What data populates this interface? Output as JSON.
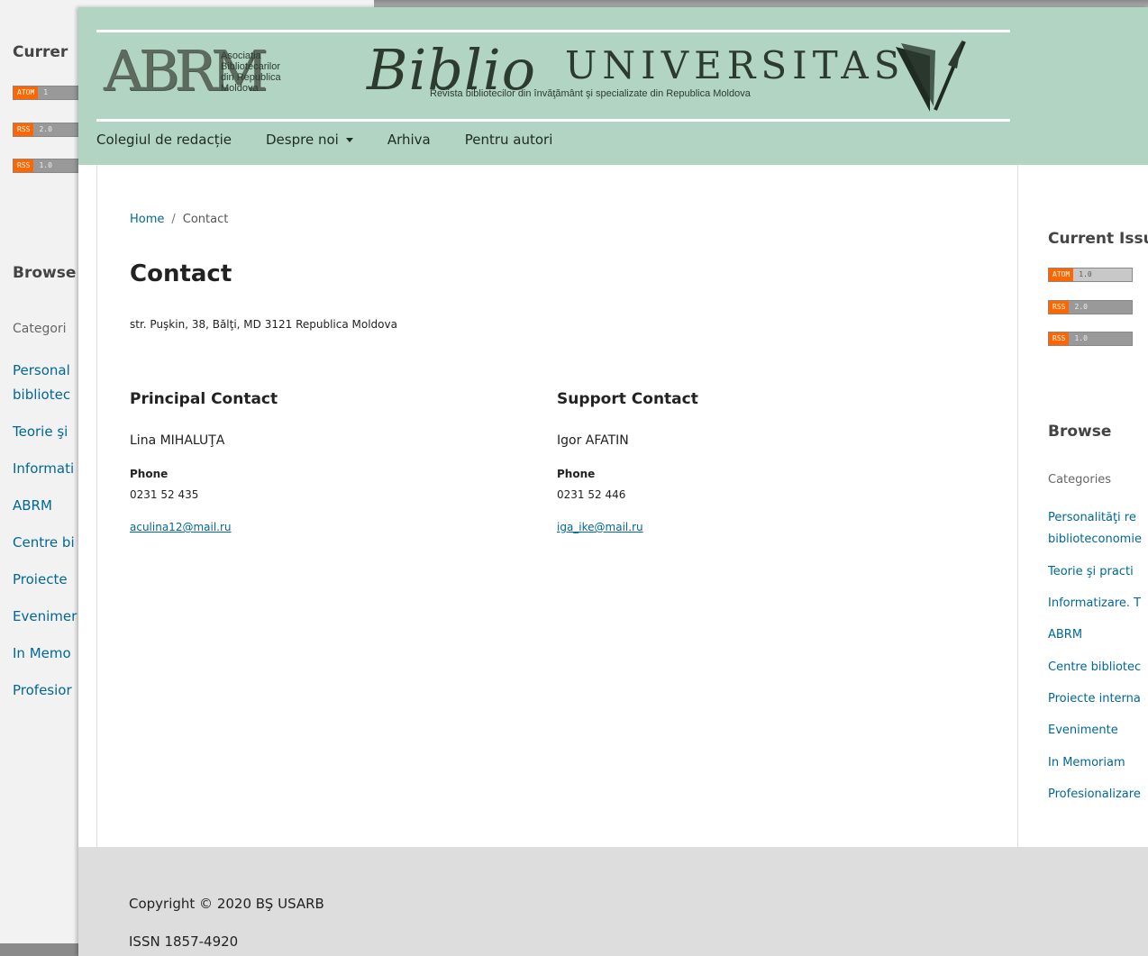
{
  "background_window": {
    "current_title": "Currer",
    "browse_title": "Browse",
    "categories_label": "Categori",
    "categories": [
      "Personal",
      "bibliotec",
      "Teorie şi",
      "Informati",
      "ABRM",
      "Centre bi",
      "Proiecte",
      "Evenimer",
      "In Memo",
      "Profesior"
    ],
    "feeds": [
      {
        "left": "ATOM",
        "right": "1"
      },
      {
        "left": "RSS",
        "right": "2.0"
      },
      {
        "left": "RSS",
        "right": "1.0"
      }
    ]
  },
  "banner": {
    "abrm": "ABRM",
    "abrm_subtitle": [
      "Asociația",
      "Bibliotecarilor",
      "din Republica",
      "Moldova"
    ],
    "biblio": "Biblio",
    "universitas": "UNIVERSITAS",
    "tagline": "Revista bibliotecilor din învăţământ şi specializate din Republica Moldova"
  },
  "nav": {
    "items": [
      {
        "label": "Colegiul de redacție"
      },
      {
        "label": "Despre noi"
      },
      {
        "label": "Arhiva"
      },
      {
        "label": "Pentru autori"
      }
    ]
  },
  "breadcrumb": {
    "home": "Home",
    "separator": "/",
    "current": "Contact"
  },
  "page": {
    "title": "Contact",
    "address": "str. Puşkin, 38, Bălţi, MD 3121 Republica Moldova"
  },
  "principal": {
    "heading": "Principal Contact",
    "name": "Lina MIHALUŢA",
    "phone_label": "Phone",
    "phone": "0231 52 435",
    "email": "aculina12@mail.ru"
  },
  "support": {
    "heading": "Support Contact",
    "name": "Igor AFATIN",
    "phone_label": "Phone",
    "phone": "0231 52 446",
    "email": "iga_ike@mail.ru"
  },
  "sidebar": {
    "current_title": "Current Issu",
    "feeds": [
      {
        "left": "ATOM",
        "right": "1.0"
      },
      {
        "left": "RSS",
        "right": "2.0"
      },
      {
        "left": "RSS",
        "right": "1.0"
      }
    ],
    "browse_title": "Browse",
    "categories_label": "Categories",
    "categories": [
      "Personalităţi re",
      "biblioteconomie",
      "Teorie şi practi",
      "Informatizare. T",
      "ABRM",
      "Centre bibliotec",
      "Proiecte interna",
      "Evenimente",
      "In Memoriam",
      "Profesionalizare"
    ]
  },
  "footer": {
    "copyright": "Copyright © 2020 BŞ USARB",
    "issn": "ISSN 1857-4920"
  },
  "colors": {
    "header_green": "#b2d4c3",
    "link_blue": "#006798",
    "footer_gray": "#dddddd",
    "feed_orange": "#ff6600"
  }
}
